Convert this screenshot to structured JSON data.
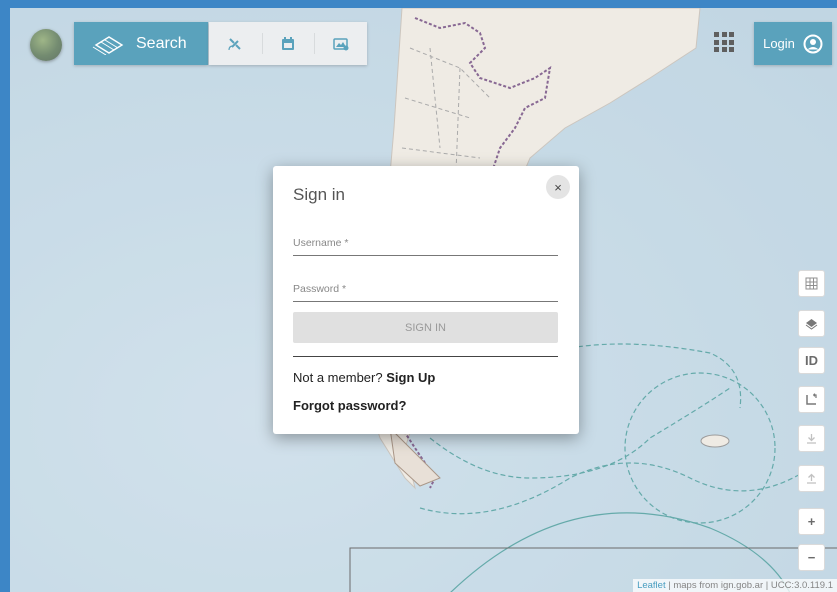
{
  "toolbar": {
    "search_label": "Search",
    "login_label": "Login"
  },
  "map_controls": {
    "identify_label": "ID",
    "zoom_in": "+",
    "zoom_out": "−"
  },
  "attribution": {
    "leaflet": "Leaflet",
    "text": " | maps from ign.gob.ar | UCC:3.0.119.1"
  },
  "dialog": {
    "title": "Sign in",
    "close_symbol": "×",
    "username_placeholder": "Username *",
    "password_placeholder": "Password *",
    "signin_button": "SIGN IN",
    "not_member_text": "Not a member?",
    "signup_link": "Sign Up",
    "forgot_link": "Forgot password?"
  },
  "colors": {
    "brand": "#1b7fa3",
    "frame": "#3d86c6"
  }
}
